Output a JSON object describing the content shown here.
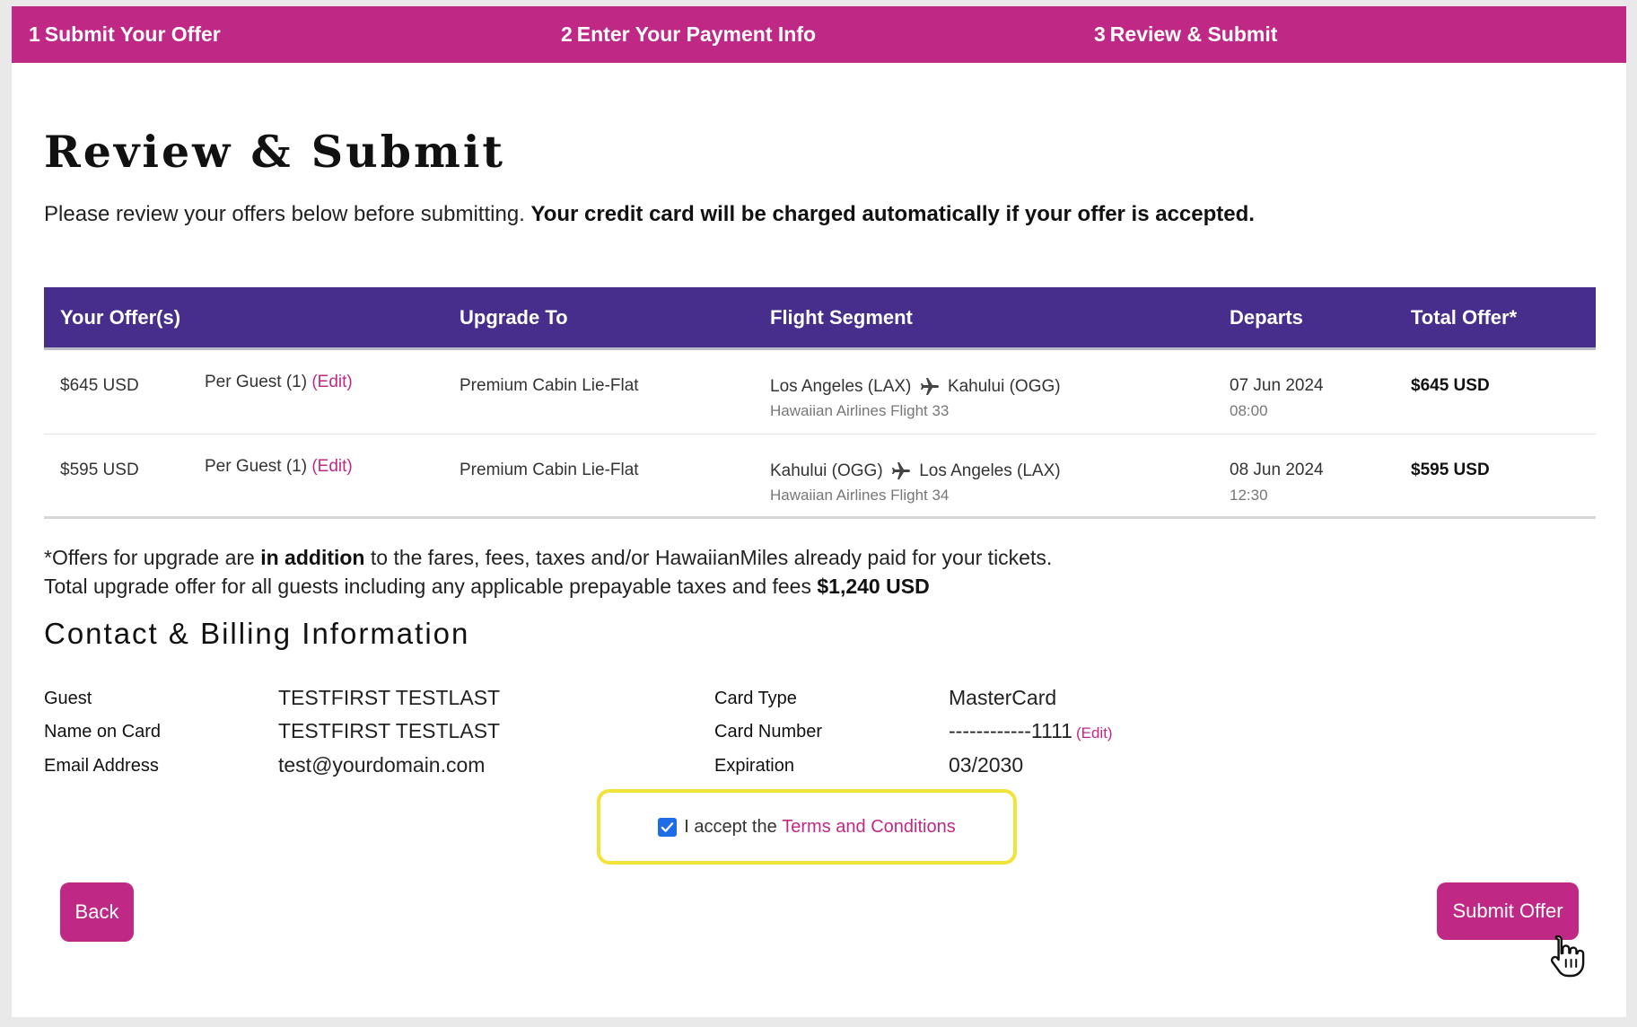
{
  "steps": [
    {
      "num": "1",
      "label": "Submit Your Offer"
    },
    {
      "num": "2",
      "label": "Enter Your Payment Info"
    },
    {
      "num": "3",
      "label": "Review & Submit"
    }
  ],
  "page": {
    "title": "Review & Submit",
    "intro_text": "Please review your offers below before submitting. ",
    "intro_bold": "Your credit card will be charged automatically if your offer is accepted."
  },
  "table": {
    "headers": [
      "Your Offer(s)",
      "Upgrade To",
      "Flight Segment",
      "Departs",
      "Total Offer*"
    ],
    "rows": [
      {
        "offer": "$645 USD",
        "per_guest": "Per Guest (1)",
        "edit": "(Edit)",
        "upgrade_to": "Premium Cabin Lie-Flat",
        "from": "Los Angeles (LAX)",
        "to": "Kahului (OGG)",
        "flight": "Hawaiian Airlines Flight 33",
        "date": "07 Jun 2024",
        "time": "08:00",
        "total": "$645 USD"
      },
      {
        "offer": "$595 USD",
        "per_guest": "Per Guest (1)",
        "edit": "(Edit)",
        "upgrade_to": "Premium Cabin Lie-Flat",
        "from": "Kahului (OGG)",
        "to": "Los Angeles (LAX)",
        "flight": "Hawaiian Airlines Flight 34",
        "date": "08 Jun 2024",
        "time": "12:30",
        "total": "$595 USD"
      }
    ]
  },
  "notes": {
    "line1_a": "*Offers for upgrade are ",
    "line1_b": "in addition",
    "line1_c": " to the fares, fees, taxes and/or HawaiianMiles already paid for your tickets.",
    "line2_a": "Total upgrade offer for all guests including any applicable prepayable taxes and fees ",
    "line2_b": "$1,240 USD"
  },
  "billing": {
    "title": "Contact & Billing Information",
    "guest_label": "Guest",
    "guest_value": "TESTFIRST TESTLAST",
    "name_label": "Name on Card",
    "name_value": "TESTFIRST TESTLAST",
    "email_label": "Email Address",
    "email_value": "test@yourdomain.com",
    "card_type_label": "Card Type",
    "card_type_value": "MasterCard",
    "card_number_label": "Card Number",
    "card_number_value": "------------1111",
    "card_number_edit": "(Edit)",
    "expiration_label": "Expiration",
    "expiration_value": "03/2030"
  },
  "terms": {
    "checked": true,
    "text": "I accept the ",
    "link": "Terms and Conditions"
  },
  "buttons": {
    "back": "Back",
    "submit": "Submit Offer"
  },
  "colors": {
    "brand": "#bf2985",
    "table_header": "#472d8c",
    "highlight": "#f2e23a",
    "checkbox": "#1f6ce8"
  }
}
